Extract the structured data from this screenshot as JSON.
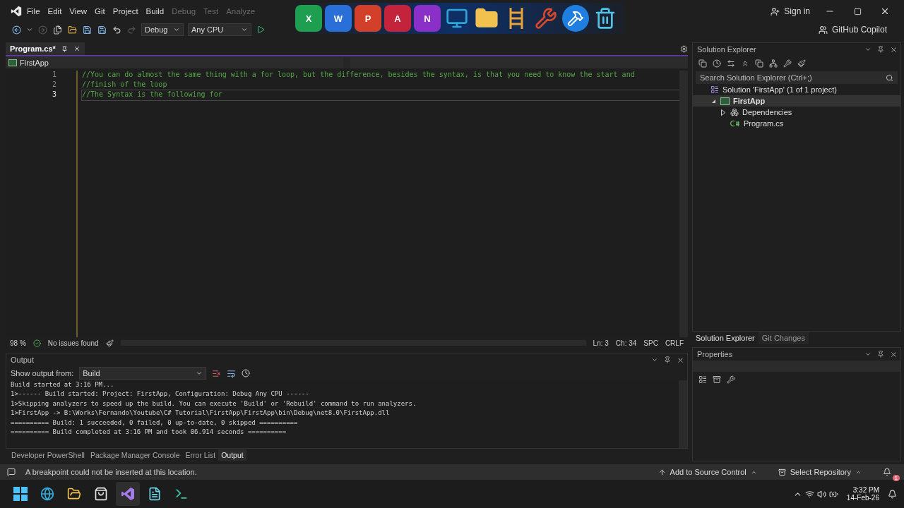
{
  "menu": [
    {
      "label": "File",
      "dimmed": false
    },
    {
      "label": "Edit",
      "dimmed": false
    },
    {
      "label": "View",
      "dimmed": false
    },
    {
      "label": "Git",
      "dimmed": false
    },
    {
      "label": "Project",
      "dimmed": false
    },
    {
      "label": "Build",
      "dimmed": false
    },
    {
      "label": "Debug",
      "dimmed": true
    },
    {
      "label": "Test",
      "dimmed": true
    },
    {
      "label": "Analyze",
      "dimmed": true
    }
  ],
  "dock": [
    {
      "kind": "letter",
      "letter": "X",
      "color": "#1e9e4f"
    },
    {
      "kind": "letter",
      "letter": "W",
      "color": "#2a6fd8"
    },
    {
      "kind": "letter",
      "letter": "P",
      "color": "#d2402a"
    },
    {
      "kind": "letter",
      "letter": "A",
      "color": "#c3243c"
    },
    {
      "kind": "letter",
      "letter": "N",
      "color": "#8a2fc8"
    },
    {
      "kind": "screen",
      "color": "#2aa6d8"
    },
    {
      "kind": "folder",
      "color": "#f2c14e"
    },
    {
      "kind": "ladder",
      "color": "#e9a23b"
    },
    {
      "kind": "tools",
      "color": "#d9472b"
    },
    {
      "kind": "hammer",
      "color": "#1e7fe0"
    },
    {
      "kind": "trash",
      "color": "#4fc3e8"
    }
  ],
  "account": {
    "label": "Sign in"
  },
  "toolbar": {
    "configuration": "Debug",
    "platform": "Any CPU"
  },
  "copilot": {
    "label": "GitHub Copilot"
  },
  "document_tabs": [
    {
      "label": "Program.cs*",
      "selected": true
    }
  ],
  "nav_bar": {
    "project": "FirstApp"
  },
  "code_lines": [
    {
      "number": "1",
      "text": "//You can do almost the same thing with a for loop, but the difference, besides the syntax, is that you need to know the start and",
      "current": false
    },
    {
      "number": "2",
      "text": "//finish of the loop",
      "current": false
    },
    {
      "number": "3",
      "text": "//The Syntax is the following for",
      "current": true
    }
  ],
  "editor_status": {
    "zoom": "98 %",
    "issues": "No issues found",
    "line": "Ln: 3",
    "column": "Ch: 34",
    "whitespace": "SPC",
    "line_ending": "CRLF"
  },
  "output": {
    "title": "Output",
    "source_label": "Show output from:",
    "source": "Build",
    "lines": [
      "Build started at 3:16 PM...",
      "1>------ Build started: Project: FirstApp, Configuration: Debug Any CPU ------",
      "1>Skipping analyzers to speed up the build. You can execute 'Build' or 'Rebuild' command to run analyzers.",
      "1>FirstApp -> B:\\Works\\Fernando\\Youtube\\C# Tutorial\\FirstApp\\FirstApp\\bin\\Debug\\net8.0\\FirstApp.dll",
      "========== Build: 1 succeeded, 0 failed, 0 up-to-date, 0 skipped ==========",
      "========== Build completed at 3:16 PM and took 06.914 seconds =========="
    ]
  },
  "bottom_tabs": [
    {
      "label": "Developer PowerShell",
      "selected": false
    },
    {
      "label": "Package Manager Console",
      "selected": false
    },
    {
      "label": "Error List",
      "selected": false
    },
    {
      "label": "Output",
      "selected": true
    }
  ],
  "solution_explorer": {
    "title": "Solution Explorer",
    "search": {
      "placeholder": "Search Solution Explorer (Ctrl+;)"
    },
    "tree": [
      {
        "label": "Solution 'FirstApp' (1 of 1 project)",
        "kind": "solution",
        "selected": false,
        "children": [
          {
            "label": "FirstApp",
            "kind": "project",
            "selected": true,
            "expanded": true,
            "children": [
              {
                "label": "Dependencies",
                "kind": "dependencies",
                "selected": false,
                "expanded": false
              },
              {
                "label": "Program.cs",
                "kind": "file",
                "selected": false
              }
            ]
          }
        ]
      }
    ]
  },
  "side_tabs": [
    {
      "label": "Solution Explorer",
      "selected": true
    },
    {
      "label": "Git Changes",
      "selected": false
    }
  ],
  "properties": {
    "title": "Properties"
  },
  "status_bar": {
    "message": "A breakpoint could not be inserted at this location.",
    "source_control": "Add to Source Control",
    "repository": "Select Repository",
    "notifications": "1"
  },
  "taskbar": {
    "apps": [
      {
        "kind": "start",
        "selected": false
      },
      {
        "kind": "browser",
        "selected": false
      },
      {
        "kind": "files",
        "selected": false
      },
      {
        "kind": "store",
        "selected": false
      },
      {
        "kind": "studio",
        "selected": true
      },
      {
        "kind": "notepad",
        "selected": false
      },
      {
        "kind": "terminal",
        "selected": false
      }
    ],
    "time": "3:32 PM",
    "date": "14-Feb-26"
  }
}
